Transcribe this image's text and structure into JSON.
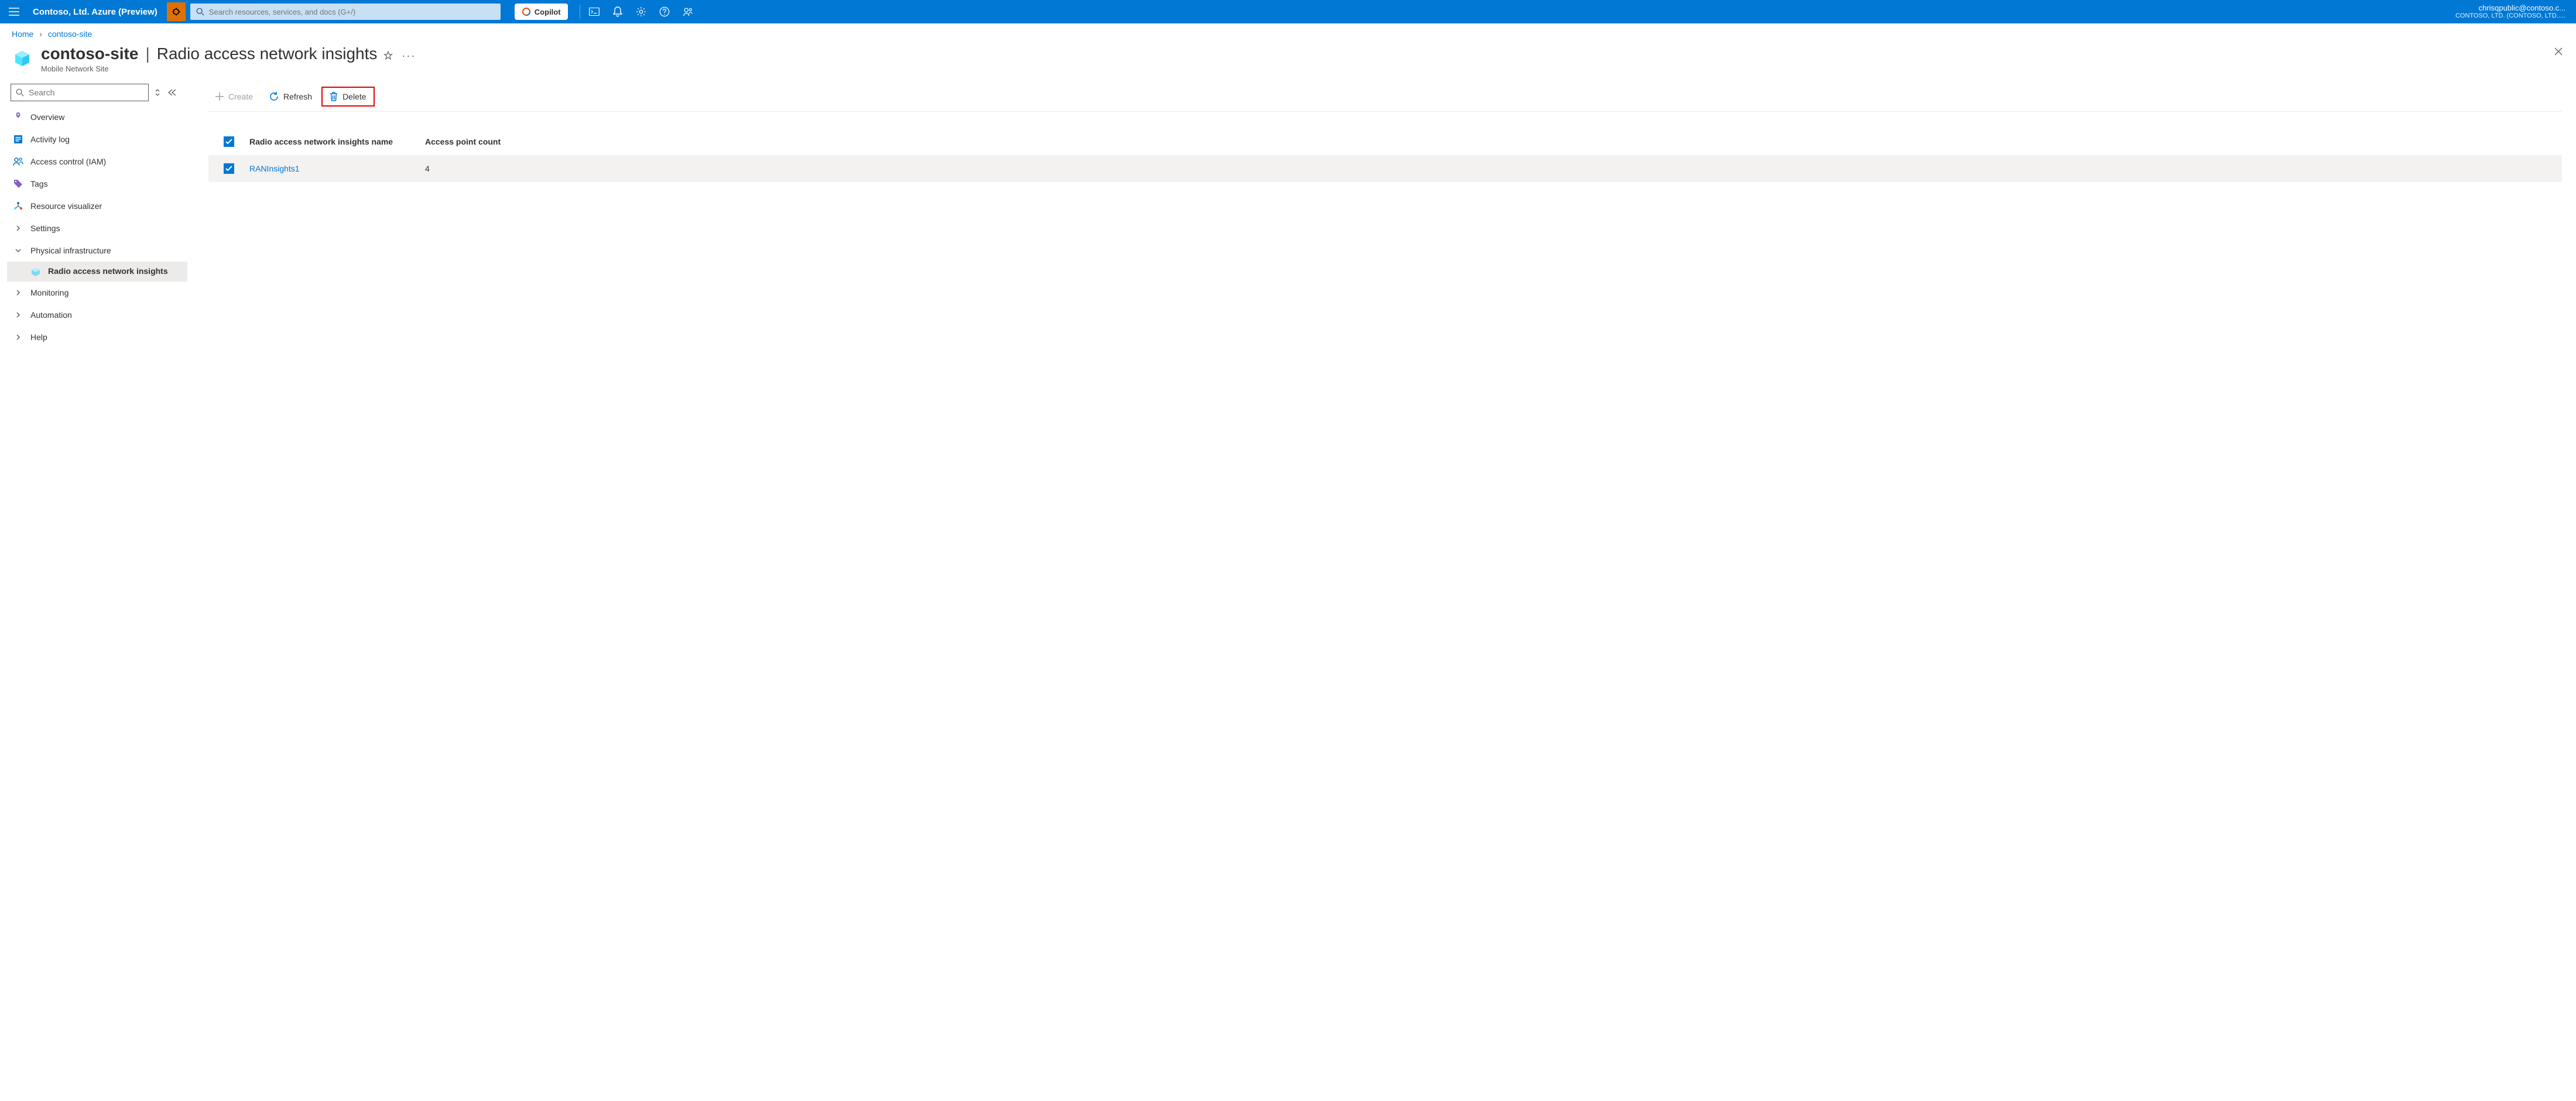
{
  "topbar": {
    "tenant": "Contoso, Ltd. Azure (Preview)",
    "search_placeholder": "Search resources, services, and docs (G+/)",
    "copilot_label": "Copilot",
    "account_email": "chrisqpublic@contoso.c...",
    "account_directory": "CONTOSO, LTD. (CONTOSO, LTD....."
  },
  "breadcrumb": {
    "home": "Home",
    "resource": "contoso-site"
  },
  "page": {
    "title": "contoso-site",
    "section": "Radio access network insights",
    "subtitle": "Mobile Network Site"
  },
  "sidebar": {
    "search_placeholder": "Search",
    "items": {
      "overview": "Overview",
      "activity_log": "Activity log",
      "iam": "Access control (IAM)",
      "tags": "Tags",
      "resource_visualizer": "Resource visualizer",
      "settings": "Settings",
      "physical_infra": "Physical infrastructure",
      "ran_insights": "Radio access network insights",
      "monitoring": "Monitoring",
      "automation": "Automation",
      "help": "Help"
    }
  },
  "toolbar": {
    "create": "Create",
    "refresh": "Refresh",
    "delete": "Delete"
  },
  "table": {
    "headers": {
      "name": "Radio access network insights name",
      "count": "Access point count"
    },
    "rows": [
      {
        "name": "RANInsights1",
        "count": "4"
      }
    ]
  }
}
